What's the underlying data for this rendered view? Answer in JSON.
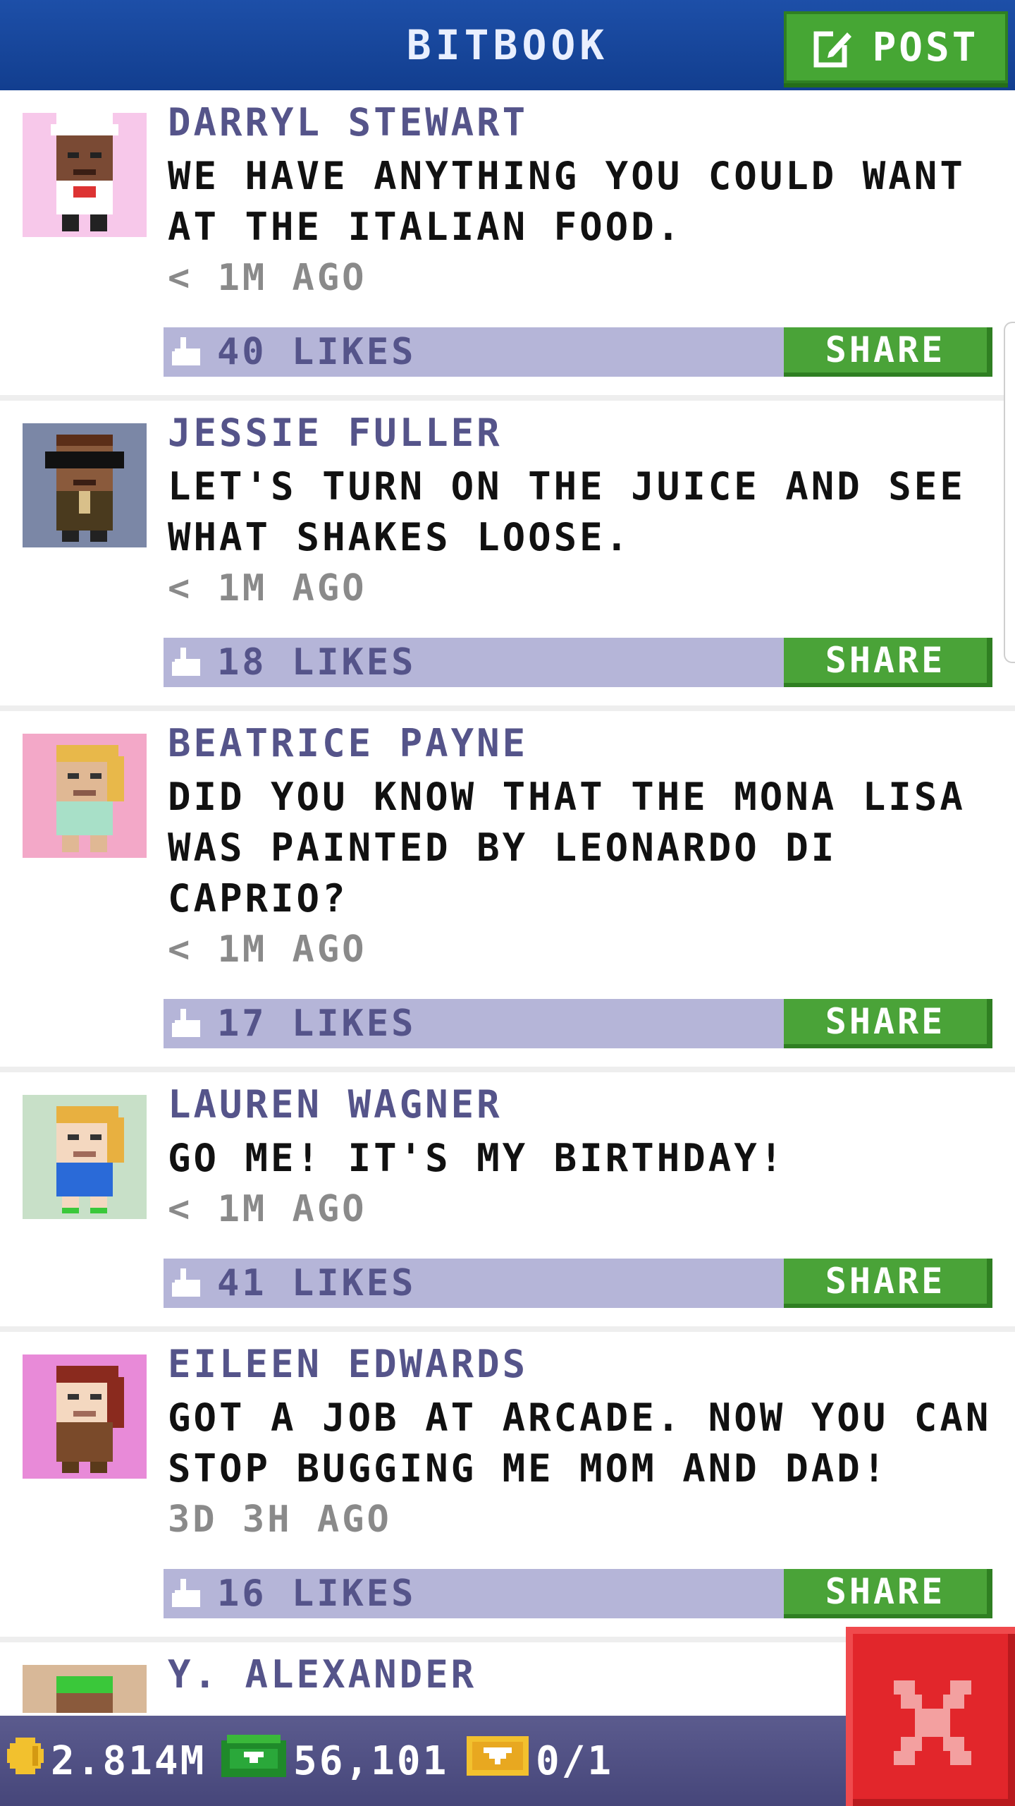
{
  "header": {
    "title": "BITBOOK",
    "post_label": "POST"
  },
  "feed": {
    "posts": [
      {
        "name": "DARRYL STEWART",
        "message": "WE HAVE ANYTHING YOU COULD WANT AT THE ITALIAN FOOD.",
        "time": "< 1M AGO",
        "likes": "40 LIKES",
        "share": "SHARE"
      },
      {
        "name": "JESSIE FULLER",
        "message": "LET'S TURN ON THE JUICE AND SEE WHAT SHAKES LOOSE.",
        "time": "< 1M AGO",
        "likes": "18 LIKES",
        "share": "SHARE"
      },
      {
        "name": "BEATRICE PAYNE",
        "message": "DID YOU KNOW THAT THE MONA LISA WAS PAINTED BY LEONARDO DI CAPRIO?",
        "time": "< 1M AGO",
        "likes": "17 LIKES",
        "share": "SHARE"
      },
      {
        "name": "LAUREN WAGNER",
        "message": "GO ME! IT'S MY BIRTHDAY!",
        "time": "< 1M AGO",
        "likes": "41 LIKES",
        "share": "SHARE"
      },
      {
        "name": "EILEEN EDWARDS",
        "message": "GOT A JOB AT ARCADE. NOW YOU CAN STOP BUGGING ME MOM AND DAD!",
        "time": "3D 3H AGO",
        "likes": "16 LIKES",
        "share": "SHARE"
      },
      {
        "name": "Y. ALEXANDER"
      }
    ]
  },
  "bottom_bar": {
    "coins": "2.814M",
    "bux": "56,101",
    "tickets": "0/1"
  },
  "colors": {
    "header_bg": "#1a4a9f",
    "post_button": "#46a634",
    "likes_bar": "#b5b5d8",
    "share_button": "#4aa338",
    "name_text": "#55548a",
    "bottom_bar": "#55558a",
    "close_button": "#e2262b"
  },
  "icons": {
    "post": "edit-icon",
    "like": "thumbs-up-icon",
    "coins": "coin-icon",
    "bux": "bux-icon",
    "tickets": "ticket-icon",
    "close": "close-icon"
  }
}
